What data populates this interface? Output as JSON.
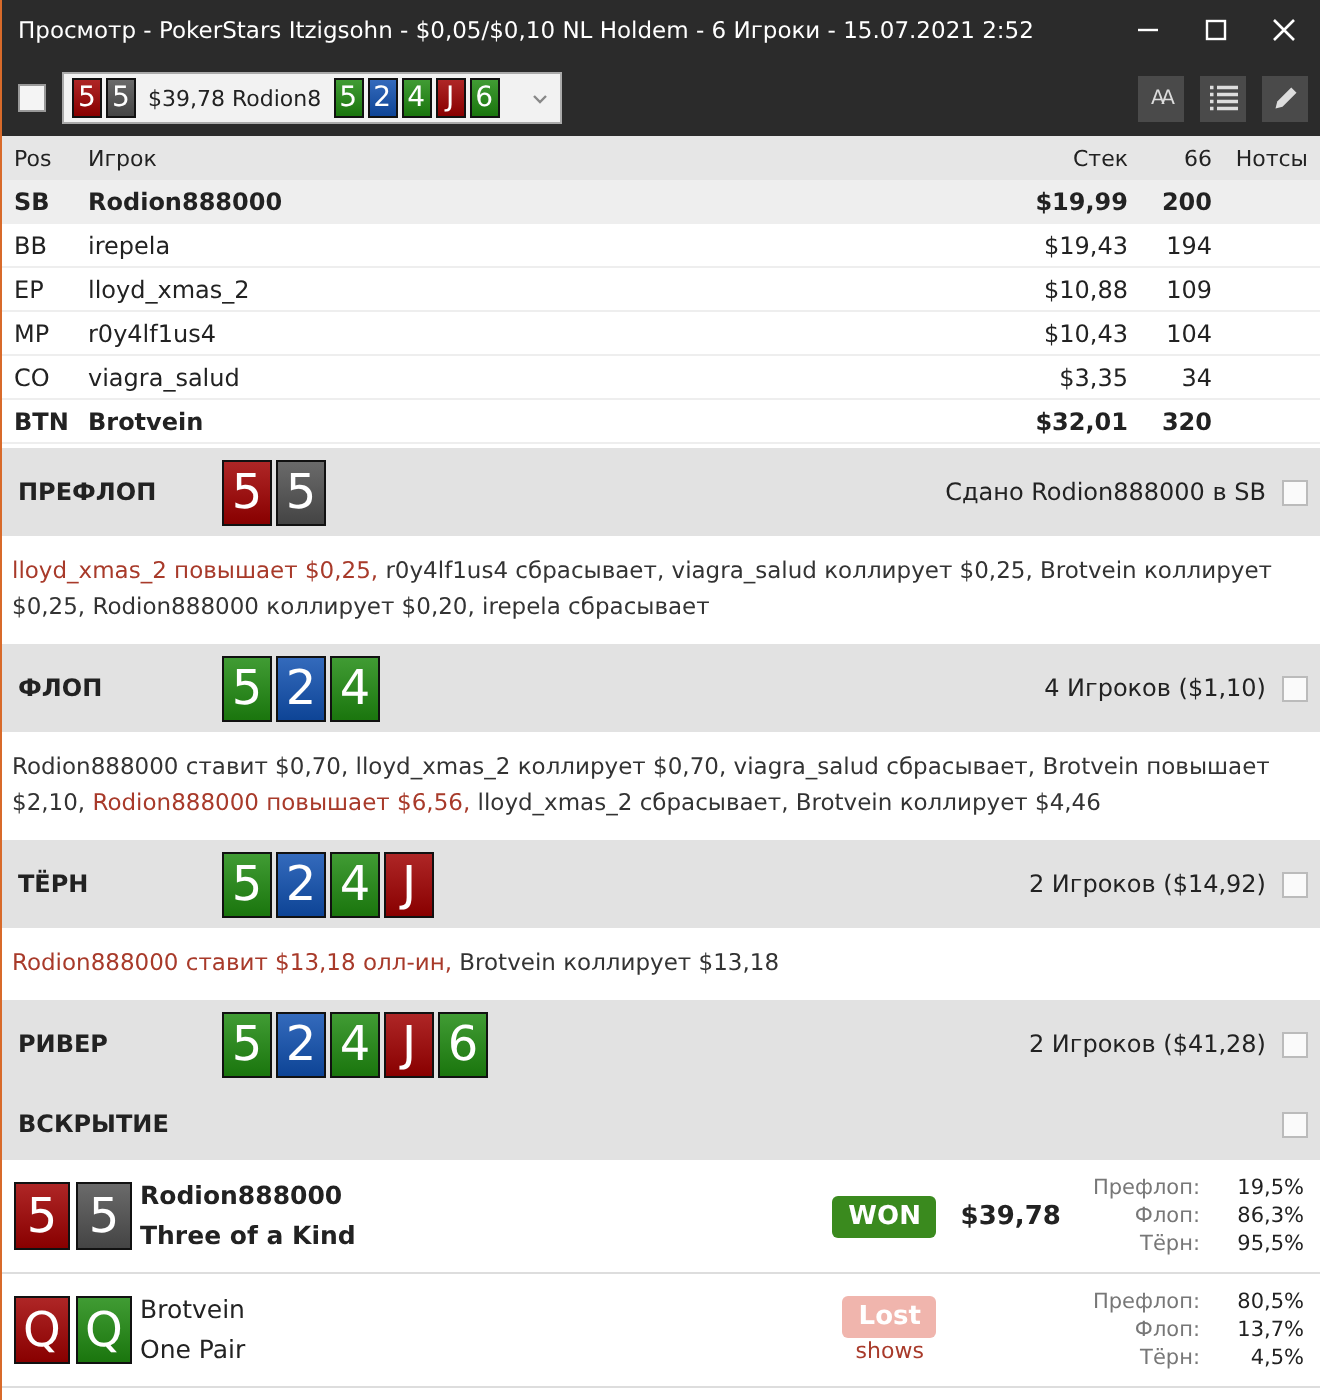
{
  "window": {
    "title": "Просмотр - PokerStars Itzigsohn - $0,05/$0,10 NL Holdem - 6 Игроки - 15.07.2021 2:52"
  },
  "toolbar": {
    "checked": false,
    "hand_selector": {
      "hole_cards": [
        {
          "rank": "5",
          "color": "#a00000"
        },
        {
          "rank": "5",
          "color": "#505050"
        }
      ],
      "text": "$39,78 Rodion8",
      "board": [
        {
          "rank": "5",
          "color": "#1f8a10"
        },
        {
          "rank": "2",
          "color": "#1050b0"
        },
        {
          "rank": "4",
          "color": "#1f8a10"
        },
        {
          "rank": "J",
          "color": "#a00000"
        },
        {
          "rank": "6",
          "color": "#1f8a10"
        }
      ]
    },
    "font_button": "AA"
  },
  "table": {
    "columns": [
      "Pos",
      "Игрок",
      "Стек",
      "66",
      "Нотсы"
    ],
    "rows": [
      {
        "pos": "SB",
        "player": "Rodion888000",
        "stack": "$19,99",
        "col_66": "200",
        "bold": true,
        "selected": true
      },
      {
        "pos": "BB",
        "player": "irepela",
        "stack": "$19,43",
        "col_66": "194",
        "bold": false,
        "selected": false
      },
      {
        "pos": "EP",
        "player": "lloyd_xmas_2",
        "stack": "$10,88",
        "col_66": "109",
        "bold": false,
        "selected": false
      },
      {
        "pos": "MP",
        "player": "r0y4lf1us4",
        "stack": "$10,43",
        "col_66": "104",
        "bold": false,
        "selected": false
      },
      {
        "pos": "CO",
        "player": "viagra_salud",
        "stack": "$3,35",
        "col_66": "34",
        "bold": false,
        "selected": false
      },
      {
        "pos": "BTN",
        "player": "Brotvein",
        "stack": "$32,01",
        "col_66": "320",
        "bold": true,
        "selected": false
      }
    ]
  },
  "streets": [
    {
      "name": "ПРЕФЛОП",
      "cards": [
        {
          "rank": "5",
          "color": "#a00000"
        },
        {
          "rank": "5",
          "color": "#505050"
        }
      ],
      "info": "Сдано Rodion888000 в SB",
      "checked": false,
      "actions": [
        {
          "text": "lloyd_xmas_2 повышает $0,25,",
          "highlight": true
        },
        {
          "text": "r0y4lf1us4 сбрасывает, viagra_salud коллирует $0,25, Brotvein коллирует $0,25, Rodion888000 коллирует $0,20, irepela сбрасывает",
          "highlight": false
        }
      ]
    },
    {
      "name": "ФЛОП",
      "cards": [
        {
          "rank": "5",
          "color": "#1f8a10"
        },
        {
          "rank": "2",
          "color": "#1050b0"
        },
        {
          "rank": "4",
          "color": "#1f8a10"
        }
      ],
      "info": "4 Игроков ($1,10)",
      "checked": false,
      "actions": [
        {
          "text": "Rodion888000 ставит $0,70, lloyd_xmas_2 коллирует $0,70, viagra_salud сбрасывает, Brotvein повышает $2,10,",
          "highlight": false
        },
        {
          "text": "Rodion888000 повышает $6,56,",
          "highlight": true
        },
        {
          "text": "lloyd_xmas_2 сбрасывает, Brotvein коллирует $4,46",
          "highlight": false
        }
      ]
    },
    {
      "name": "ТЁРН",
      "cards": [
        {
          "rank": "5",
          "color": "#1f8a10"
        },
        {
          "rank": "2",
          "color": "#1050b0"
        },
        {
          "rank": "4",
          "color": "#1f8a10"
        },
        {
          "rank": "J",
          "color": "#a00000"
        }
      ],
      "info": "2 Игроков ($14,92)",
      "checked": false,
      "actions": [
        {
          "text": "Rodion888000 ставит $13,18 олл-ин,",
          "highlight": true
        },
        {
          "text": "Brotvein коллирует $13,18",
          "highlight": false
        }
      ]
    },
    {
      "name": "РИВЕР",
      "cards": [
        {
          "rank": "5",
          "color": "#1f8a10"
        },
        {
          "rank": "2",
          "color": "#1050b0"
        },
        {
          "rank": "4",
          "color": "#1f8a10"
        },
        {
          "rank": "J",
          "color": "#a00000"
        },
        {
          "rank": "6",
          "color": "#1f8a10"
        }
      ],
      "info": "2 Игроков ($41,28)",
      "checked": false
    }
  ],
  "showdown": {
    "title": "ВСКРЫТИЕ",
    "checked": false,
    "players": [
      {
        "cards": [
          {
            "rank": "5",
            "color": "#a00000"
          },
          {
            "rank": "5",
            "color": "#505050"
          }
        ],
        "name": "Rodion888000",
        "hand": "Three of a Kind",
        "result": {
          "kind": "won",
          "label": "WON"
        },
        "amount": "$39,78",
        "bold": true,
        "equity": [
          {
            "label": "Префлоп:",
            "value": "19,5%"
          },
          {
            "label": "Флоп:",
            "value": "86,3%"
          },
          {
            "label": "Тёрн:",
            "value": "95,5%"
          }
        ]
      },
      {
        "cards": [
          {
            "rank": "Q",
            "color": "#a00000"
          },
          {
            "rank": "Q",
            "color": "#1f8a10"
          }
        ],
        "name": "Brotvein",
        "hand": "One Pair",
        "result": {
          "kind": "lost",
          "label": "Lost"
        },
        "note": "shows",
        "bold": false,
        "equity": [
          {
            "label": "Префлоп:",
            "value": "80,5%"
          },
          {
            "label": "Флоп:",
            "value": "13,7%"
          },
          {
            "label": "Тёрн:",
            "value": "4,5%"
          }
        ]
      }
    ]
  }
}
